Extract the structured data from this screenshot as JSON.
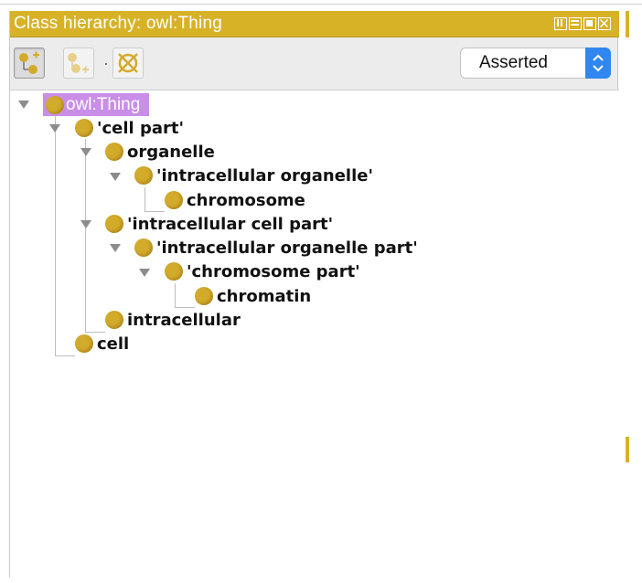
{
  "panel": {
    "title": "Class hierarchy: owl:Thing",
    "window_controls": [
      "view-icon",
      "minimize-icon",
      "maximize-icon",
      "close-icon"
    ]
  },
  "toolbar": {
    "buttons": [
      {
        "name": "add-subclass-icon",
        "active": true
      },
      {
        "name": "add-sibling-class-icon",
        "active": false
      },
      {
        "name": "delete-class-icon",
        "active": false
      }
    ],
    "view_select": {
      "value": "Asserted"
    }
  },
  "tree": {
    "root": "owl:Thing",
    "nodes": [
      {
        "label": "'cell part'",
        "expanded": true
      },
      {
        "label": "organelle",
        "expanded": true
      },
      {
        "label": "'intracellular organelle'",
        "expanded": true
      },
      {
        "label": "chromosome",
        "expanded": false
      },
      {
        "label": "'intracellular cell part'",
        "expanded": true
      },
      {
        "label": "'intracellular organelle part'",
        "expanded": true
      },
      {
        "label": "'chromosome part'",
        "expanded": true
      },
      {
        "label": "chromatin",
        "expanded": false
      },
      {
        "label": "intracellular",
        "expanded": false
      },
      {
        "label": "cell",
        "expanded": false
      }
    ]
  },
  "colors": {
    "title_bar": "#d7b227",
    "class_icon": "#d3ab2b",
    "selection": "#c98ee8",
    "select_arrow": "#2f87ef"
  }
}
